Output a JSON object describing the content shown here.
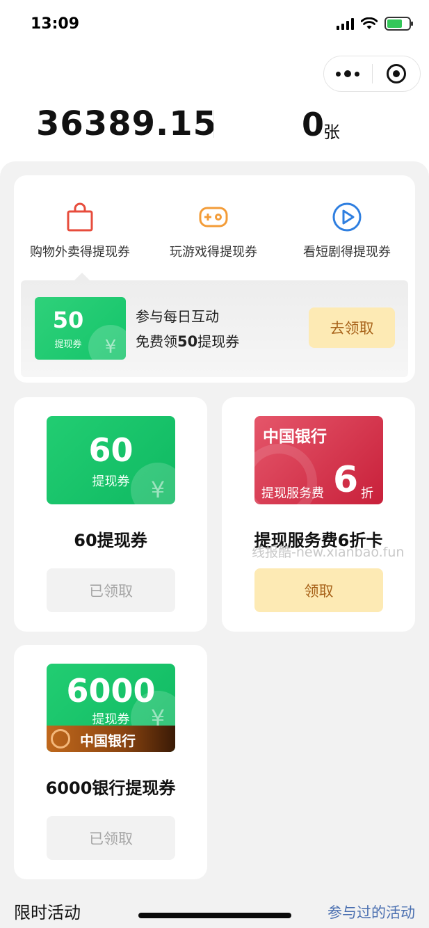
{
  "status_bar": {
    "time": "13:09"
  },
  "balance": {
    "amount": "36389.15",
    "coupon_count": "0",
    "coupon_unit": "张"
  },
  "tabs": [
    {
      "label": "购物外卖得提现券",
      "icon": "shopping-bag-icon",
      "color": "#e74c3c"
    },
    {
      "label": "玩游戏得提现券",
      "icon": "gamepad-icon",
      "color": "#f39c38"
    },
    {
      "label": "看短剧得提现券",
      "icon": "play-circle-icon",
      "color": "#2f7fe0"
    }
  ],
  "promo": {
    "ticket_value": "50",
    "ticket_label": "提现券",
    "line1": "参与每日互动",
    "line2_prefix": "免费领",
    "line2_value": "50",
    "line2_suffix": "提现券",
    "button": "去领取"
  },
  "cards": [
    {
      "ticket_value": "60",
      "ticket_label": "提现券",
      "title": "60提现券",
      "button": "已领取",
      "state": "claimed"
    },
    {
      "bank_name": "中国银行",
      "fee_label": "提现服务费",
      "discount": "6",
      "discount_unit": "折",
      "title": "提现服务费6折卡",
      "button": "领取",
      "state": "available"
    },
    {
      "ticket_value": "6000",
      "ticket_label": "提现券",
      "bank_name": "中国银行",
      "title": "6000银行提现券",
      "button": "已领取",
      "state": "claimed"
    }
  ],
  "watermark": "线报酷-new.xianbao.fun",
  "footer": {
    "left": "限时活动",
    "right": "参与过的活动"
  },
  "colors": {
    "green": "#1ec66d",
    "red": "#d2334b",
    "claim_bg": "#fdeab4",
    "claim_text": "#a8631a",
    "link": "#4a6fb0"
  }
}
